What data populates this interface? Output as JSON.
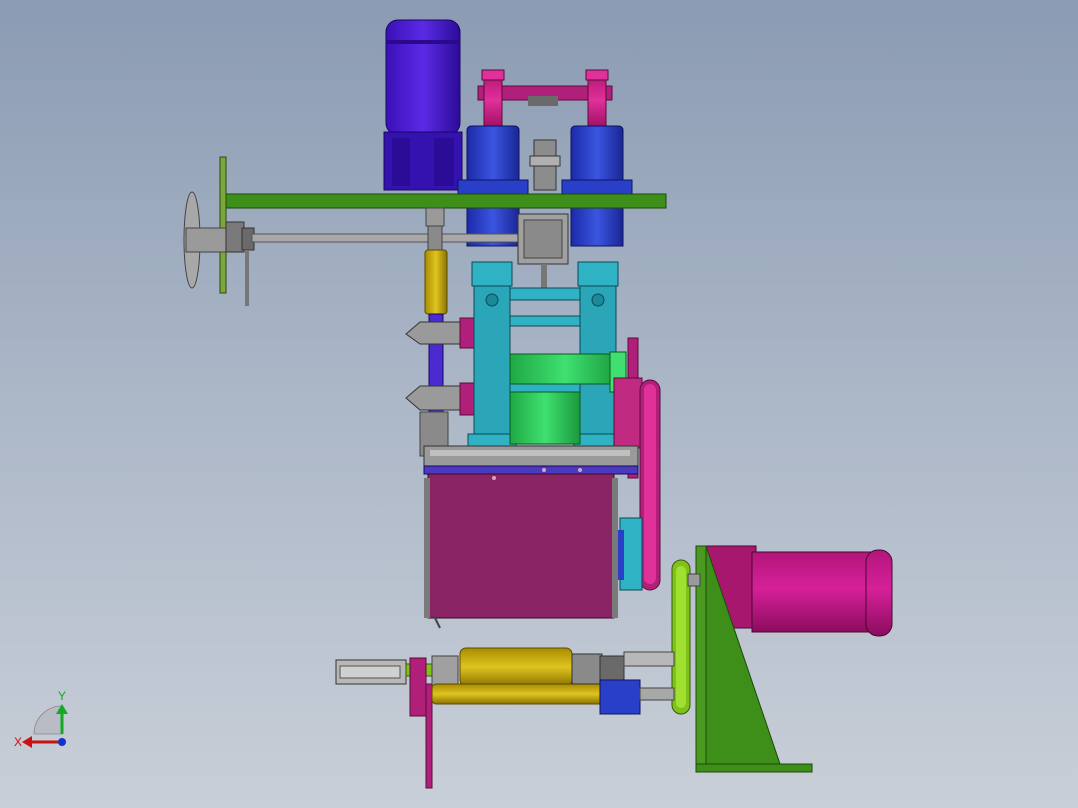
{
  "viewport": {
    "background_top": "#8b9bb3",
    "background_bottom": "#c9cfd8"
  },
  "colors": {
    "motor_blue": "#4b1fd0",
    "cylinder_blue": "#2a3fc8",
    "frame_cyan": "#2fb3c4",
    "roller_green": "#2ecc55",
    "plate_green": "#3e8f1a",
    "housing_magenta": "#8a2464",
    "pink": "#d0208a",
    "gold": "#c8a800",
    "lime": "#7fc21a",
    "gray": "#9a9a9a"
  },
  "triad": {
    "x_label": "X",
    "y_label": "Y",
    "x_color": "#cc1111",
    "y_color": "#11aa22",
    "z_color": "#1133cc"
  }
}
